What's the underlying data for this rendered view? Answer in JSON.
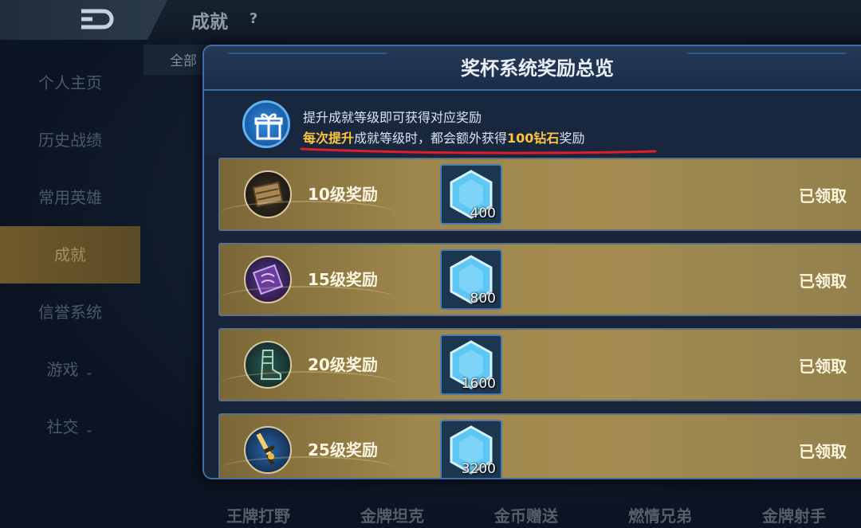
{
  "header": {
    "title": "成就",
    "help_icon": "?"
  },
  "sidebar": {
    "items": [
      {
        "label": "个人主页"
      },
      {
        "label": "历史战绩"
      },
      {
        "label": "常用英雄"
      },
      {
        "label": "成就",
        "active": true
      },
      {
        "label": "信誉系统"
      },
      {
        "label": "游戏",
        "chevron": "⌄"
      },
      {
        "label": "社交",
        "chevron": "⌄"
      }
    ]
  },
  "tabs": {
    "all_label": "全部"
  },
  "bottom_tabs": [
    "王牌打野",
    "金牌坦克",
    "金币赠送",
    "燃情兄弟",
    "金牌射手"
  ],
  "modal": {
    "title": "奖杯系统奖励总览",
    "info_line1": "提升成就等级即可获得对应奖励",
    "info_line2_parts": [
      "每次提升",
      "成就等级时，都会额外获得",
      "100钻石",
      "奖励"
    ],
    "rows": [
      {
        "label": "10级奖励",
        "gem_count": "400",
        "status": "已领取",
        "icon": "wooden-crate-icon"
      },
      {
        "label": "15级奖励",
        "gem_count": "800",
        "status": "已领取",
        "icon": "spellbook-icon"
      },
      {
        "label": "20级奖励",
        "gem_count": "1600",
        "status": "已领取",
        "icon": "boots-icon"
      },
      {
        "label": "25级奖励",
        "gem_count": "3200",
        "status": "已领取",
        "icon": "sword-icon"
      }
    ]
  },
  "colors": {
    "highlight": "#ffc53a",
    "underline": "#e01d2a",
    "modal_border": "#3d6fa6"
  }
}
